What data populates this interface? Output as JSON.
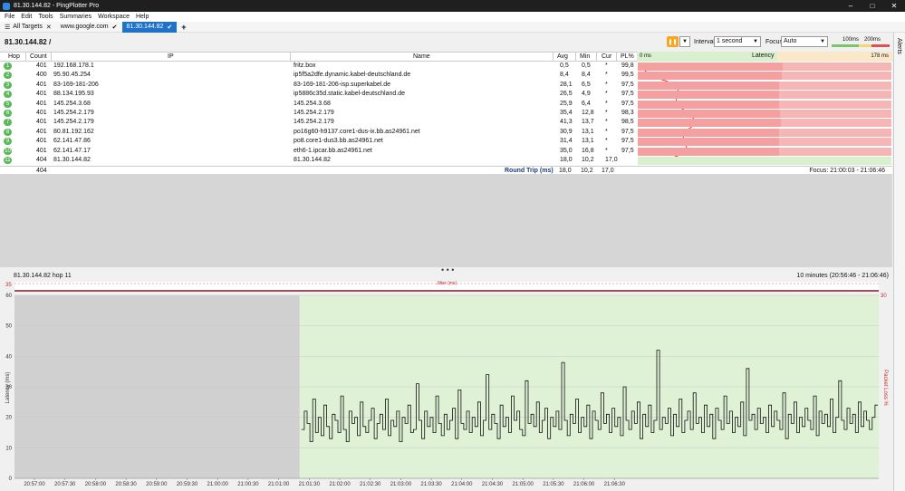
{
  "window": {
    "title": "81.30.144.82 - PingPlotter Pro",
    "controls": [
      "–",
      "□",
      "✕"
    ]
  },
  "menu": [
    "File",
    "Edit",
    "Tools",
    "Summaries",
    "Workspace",
    "Help"
  ],
  "tabs": [
    {
      "label": "All Targets",
      "mark": "✕"
    },
    {
      "label": "www.google.com",
      "mark": "✔"
    },
    {
      "label": "81.30.144.82",
      "mark": "✔"
    }
  ],
  "tab_add": "+",
  "toolbar": {
    "target": "81.30.144.82",
    "target_suffix": "/",
    "interval_label": "Interval",
    "interval_value": "1 second",
    "focus_label": "Focus",
    "focus_value": "Auto",
    "scale_100": "100ms",
    "scale_200": "200ms"
  },
  "alerts_label": "Alerts",
  "columns": {
    "hop": "Hop",
    "count": "Count",
    "ip": "IP",
    "name": "Name",
    "avg": "Avg",
    "min": "Min",
    "cur": "Cur",
    "pl": "PL%",
    "latency": "Latency",
    "lat_min": "0 ms",
    "lat_max": "178 ms"
  },
  "hops": [
    {
      "hop": "1",
      "count": "401",
      "ip": "192.168.178.1",
      "name": "fritz.box",
      "avg": "0,5",
      "min": "0,5",
      "cur": "*",
      "pl": "99,8",
      "pl_value": 99.8,
      "avg_value": 0.5,
      "max_value": 1
    },
    {
      "hop": "2",
      "count": "400",
      "ip": "95.90.45.254",
      "name": "ip5f5a2dfe.dynamic.kabel-deutschland.de",
      "avg": "8,4",
      "min": "8,4",
      "cur": "*",
      "pl": "99,5",
      "pl_value": 99.5,
      "avg_value": 8.4,
      "max_value": 9
    },
    {
      "hop": "3",
      "count": "401",
      "ip": "83-169-181-206",
      "name": "83-169-181-206-isp.superkabel.de",
      "avg": "28,1",
      "min": "6,5",
      "cur": "*",
      "pl": "97,5",
      "pl_value": 97.5,
      "avg_value": 28.1,
      "max_value": 170
    },
    {
      "hop": "4",
      "count": "401",
      "ip": "88.134.195.93",
      "name": "ip5886c35d.static.kabel-deutschland.de",
      "avg": "26,5",
      "min": "4,9",
      "cur": "*",
      "pl": "97,5",
      "pl_value": 97.5,
      "avg_value": 26.5,
      "max_value": 165
    },
    {
      "hop": "5",
      "count": "401",
      "ip": "145.254.3.68",
      "name": "145.254.3.68",
      "avg": "25,9",
      "min": "6,4",
      "cur": "*",
      "pl": "97,5",
      "pl_value": 97.5,
      "avg_value": 25.9,
      "max_value": 160
    },
    {
      "hop": "6",
      "count": "401",
      "ip": "145.254.2.179",
      "name": "145.254.2.179",
      "avg": "35,4",
      "min": "12,8",
      "cur": "*",
      "pl": "98,3",
      "pl_value": 98.3,
      "avg_value": 35.4,
      "max_value": 145
    },
    {
      "hop": "7",
      "count": "401",
      "ip": "145.254.2.179",
      "name": "145.254.2.179",
      "avg": "41,3",
      "min": "13,7",
      "cur": "*",
      "pl": "98,5",
      "pl_value": 98.5,
      "avg_value": 41.3,
      "max_value": 150
    },
    {
      "hop": "8",
      "count": "401",
      "ip": "80.81.192.162",
      "name": "po16g60-h9137.core1-dus-ix.bb.as24961.net",
      "avg": "30,9",
      "min": "13,1",
      "cur": "*",
      "pl": "97,5",
      "pl_value": 97.5,
      "avg_value": 30.9,
      "max_value": 150
    },
    {
      "hop": "9",
      "count": "401",
      "ip": "62.141.47.86",
      "name": "po8.core1-dus3.bb.as24961.net",
      "avg": "31,4",
      "min": "13,1",
      "cur": "*",
      "pl": "97,5",
      "pl_value": 97.5,
      "avg_value": 31.4,
      "max_value": 160
    },
    {
      "hop": "10",
      "count": "401",
      "ip": "62.141.47.17",
      "name": "eth6-1.ipcar.bb.as24961.net",
      "avg": "35,0",
      "min": "16,8",
      "cur": "*",
      "pl": "97,5",
      "pl_value": 97.5,
      "avg_value": 35.0,
      "max_value": 150
    },
    {
      "hop": "11",
      "count": "404",
      "ip": "81.30.144.82",
      "name": "81.30.144.82",
      "avg": "18,0",
      "min": "10,2",
      "cur": "17,0",
      "pl": "",
      "pl_value": 0,
      "avg_value": 18.0,
      "max_value": 40
    }
  ],
  "summary": {
    "count": "404",
    "label": "Round Trip (ms)",
    "avg": "18,0",
    "min": "10,2",
    "cur": "17,0",
    "focus": "Focus: 21:00:03 - 21:06:46"
  },
  "splitter_dots": "• • •",
  "timeline": {
    "title": "81.30.144.82 hop 11",
    "range": "10 minutes (20:56:46 - 21:06:46)",
    "jitter_label": "Jitter (ms)",
    "jitter_top": "35",
    "loss_top": "30",
    "y_title": "Latency (ms)",
    "y2_title": "Packet Loss %",
    "y_ticks": [
      "60",
      "50",
      "40",
      "30",
      "20",
      "10",
      "0"
    ],
    "x_ticks": [
      "20:57:00",
      "20:57:30",
      "20:58:00",
      "20:58:30",
      "20:59:00",
      "20:59:30",
      "21:00:00",
      "21:00:30",
      "21:01:00",
      "21:01:30",
      "21:02:00",
      "21:02:30",
      "21:03:00",
      "21:03:30",
      "21:04:00",
      "21:04:30",
      "21:05:00",
      "21:05:30",
      "21:06:00",
      "21:06:30"
    ]
  },
  "chart_data": {
    "type": "line",
    "y_range": [
      0,
      60
    ],
    "latency_ms": [
      16,
      22,
      18,
      12,
      26,
      15,
      20,
      14,
      24,
      17,
      13,
      21,
      19,
      15,
      27,
      16,
      12,
      22,
      18,
      20,
      14,
      25,
      17,
      15,
      19,
      23,
      13,
      18,
      21,
      16,
      26,
      14,
      19,
      17,
      22,
      12,
      20,
      18,
      24,
      15,
      16,
      31,
      19,
      13,
      22,
      17,
      20,
      15,
      27,
      18,
      14,
      21,
      16,
      19,
      23,
      13,
      29,
      18,
      16,
      22,
      15,
      20,
      17,
      25,
      14,
      19,
      34,
      16,
      21,
      18,
      13,
      24,
      17,
      20,
      15,
      27,
      19,
      22,
      16,
      14,
      32,
      18,
      21,
      17,
      25,
      15,
      19,
      23,
      13,
      20,
      17,
      22,
      16,
      38,
      19,
      14,
      21,
      18,
      26,
      15,
      20,
      17,
      24,
      13,
      22,
      19,
      16,
      28,
      18,
      21,
      15,
      23,
      17,
      20,
      14,
      30,
      19,
      16,
      22,
      18,
      25,
      13,
      21,
      17,
      24,
      15,
      19,
      42,
      16,
      20,
      18,
      23,
      14,
      21,
      17,
      26,
      15,
      19,
      22,
      16,
      28,
      18,
      20,
      15,
      24,
      17,
      21,
      13,
      23,
      19,
      16,
      27,
      18,
      22,
      15,
      20,
      17,
      25,
      14,
      36,
      19,
      21,
      16,
      23,
      18,
      20,
      15,
      24,
      17,
      22,
      19,
      16,
      28,
      13,
      21,
      18,
      25,
      15,
      20,
      17,
      23,
      19,
      16,
      27,
      14,
      22,
      18,
      21,
      17,
      26,
      15,
      20,
      32,
      19,
      16,
      23,
      18,
      21,
      15,
      25,
      17,
      22,
      19,
      16,
      20,
      24
    ],
    "focus_start_fraction": 0.33
  }
}
